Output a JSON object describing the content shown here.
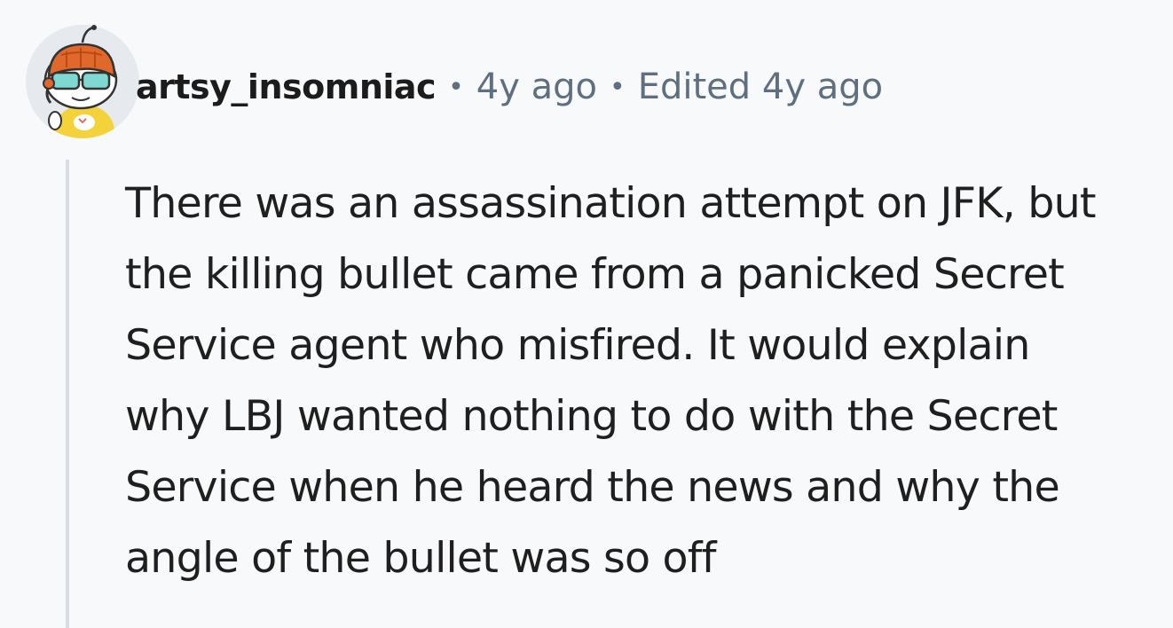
{
  "comment": {
    "username": "artsy_insomniac",
    "separator": "•",
    "posted": "4y ago",
    "edited": "Edited 4y ago",
    "avatar_icon": "snoo-avatar-icon",
    "body_text": "There was an assassination attempt on JFK, but\nthe killing bullet came from a panicked Secret\nService agent who misfired. It would explain\nwhy LBJ wanted nothing to do with the Secret\nService when he heard the news and why the\nangle of the bullet was so off"
  },
  "colors": {
    "background": "#f8f9fa",
    "username": "#1c1c1c",
    "meta": "#5f6f7f",
    "body": "#1f1f1f",
    "thread_line": "#d8dde3"
  }
}
